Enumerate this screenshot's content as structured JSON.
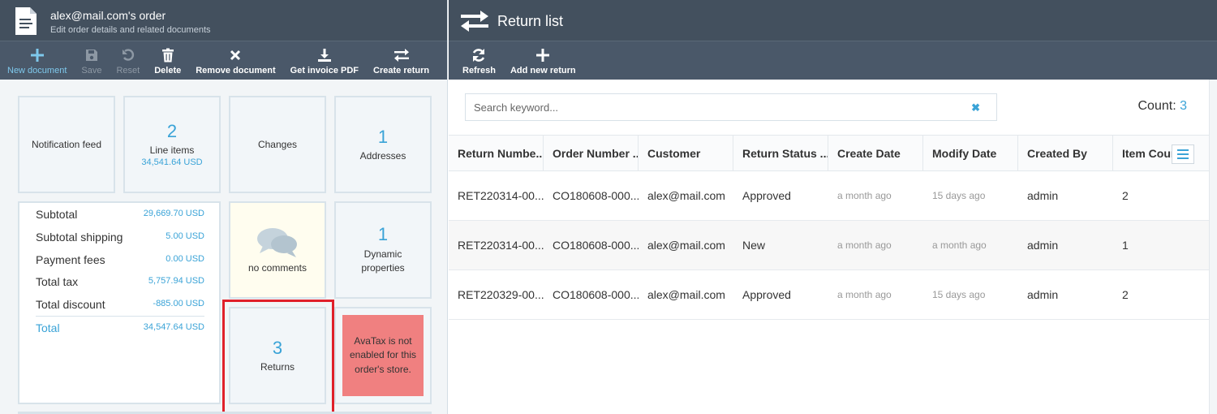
{
  "left": {
    "title": "alex@mail.com's order",
    "subtitle": "Edit order details and related documents",
    "toolbar": [
      {
        "label": "New document",
        "icon": "plus-icon",
        "state": "accent"
      },
      {
        "label": "Save",
        "icon": "save-icon",
        "state": "disabled"
      },
      {
        "label": "Reset",
        "icon": "undo-icon",
        "state": "disabled"
      },
      {
        "label": "Delete",
        "icon": "trash-icon",
        "state": "normal"
      },
      {
        "label": "Remove document",
        "icon": "close-icon",
        "state": "normal"
      },
      {
        "label": "Get invoice PDF",
        "icon": "download-icon",
        "state": "normal"
      },
      {
        "label": "Create return",
        "icon": "exchange-icon",
        "state": "normal"
      }
    ],
    "widgets": {
      "notification_feed": "Notification feed",
      "line_items": {
        "count": "2",
        "label": "Line items",
        "amount": "34,541.64 USD"
      },
      "changes": "Changes",
      "addresses": {
        "count": "1",
        "label": "Addresses"
      },
      "comments": "no comments",
      "dynamic": {
        "count": "1",
        "label": "Dynamic properties"
      },
      "returns": {
        "count": "3",
        "label": "Returns"
      },
      "avatax": "AvaTax is not enabled for this order's store."
    },
    "totals": [
      {
        "label": "Subtotal",
        "value": "29,669.70 USD"
      },
      {
        "label": "Subtotal shipping",
        "value": "5.00 USD"
      },
      {
        "label": "Payment fees",
        "value": "0.00 USD"
      },
      {
        "label": "Total tax",
        "value": "5,757.94 USD"
      },
      {
        "label": "Total discount",
        "value": "-885.00 USD"
      },
      {
        "label": "Total",
        "value": "34,547.64 USD"
      }
    ]
  },
  "right": {
    "title": "Return list",
    "toolbar": [
      {
        "label": "Refresh",
        "icon": "refresh-icon"
      },
      {
        "label": "Add new return",
        "icon": "plus-icon"
      }
    ],
    "search": {
      "placeholder": "Search keyword...",
      "value": ""
    },
    "count_label": "Count:",
    "count": "3",
    "columns": [
      "Return Numbe...",
      "Order Number ...",
      "Customer",
      "Return Status ...",
      "Create Date",
      "Modify Date",
      "Created By",
      "Item Count"
    ],
    "rows": [
      [
        "RET220314-00...",
        "CO180608-000...",
        "alex@mail.com",
        "Approved",
        "a month ago",
        "15 days ago",
        "admin",
        "2"
      ],
      [
        "RET220314-00...",
        "CO180608-000...",
        "alex@mail.com",
        "New",
        "a month ago",
        "a month ago",
        "admin",
        "1"
      ],
      [
        "RET220329-00...",
        "CO180608-000...",
        "alex@mail.com",
        "Approved",
        "a month ago",
        "15 days ago",
        "admin",
        "2"
      ]
    ]
  },
  "colors": {
    "header": "#43505e",
    "toolbar": "#4a5869",
    "accent": "#3aa3d7",
    "highlight": "#e0202a",
    "avatax": "#f08080"
  }
}
